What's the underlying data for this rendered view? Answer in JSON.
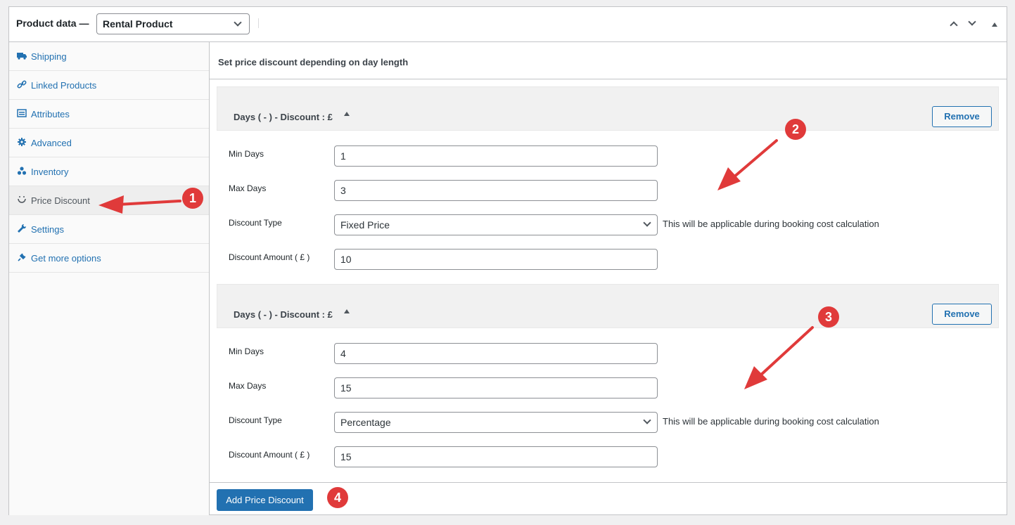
{
  "header": {
    "title": "Product data —",
    "product_type": "Rental Product"
  },
  "sidebar": {
    "items": [
      {
        "label": "Shipping",
        "icon": "truck-icon"
      },
      {
        "label": "Linked Products",
        "icon": "link-icon"
      },
      {
        "label": "Attributes",
        "icon": "list-icon"
      },
      {
        "label": "Advanced",
        "icon": "gear-icon"
      },
      {
        "label": "Inventory",
        "icon": "cubes-icon"
      },
      {
        "label": "Price Discount",
        "icon": "spinner-icon",
        "active": true
      },
      {
        "label": "Settings",
        "icon": "wrench-icon"
      },
      {
        "label": "Get more options",
        "icon": "plug-icon"
      }
    ]
  },
  "main": {
    "heading": "Set price discount depending on day length",
    "rules": [
      {
        "title": "Days ( - ) - Discount : £",
        "remove_label": "Remove",
        "min_days_label": "Min Days",
        "min_days": "1",
        "max_days_label": "Max Days",
        "max_days": "3",
        "discount_type_label": "Discount Type",
        "discount_type": "Fixed Price",
        "discount_type_hint": "This will be applicable during booking cost calculation",
        "discount_amount_label": "Discount Amount ( £ )",
        "discount_amount": "10"
      },
      {
        "title": "Days ( - ) - Discount : £",
        "remove_label": "Remove",
        "min_days_label": "Min Days",
        "min_days": "4",
        "max_days_label": "Max Days",
        "max_days": "15",
        "discount_type_label": "Discount Type",
        "discount_type": "Percentage",
        "discount_type_hint": "This will be applicable during booking cost calculation",
        "discount_amount_label": "Discount Amount ( £ )",
        "discount_amount": "15"
      }
    ],
    "add_label": "Add Price Discount"
  },
  "annotations": {
    "badges": [
      "1",
      "2",
      "3",
      "4"
    ],
    "color": "#e03a3a"
  },
  "colors": {
    "accent": "#2271b1",
    "annotation": "#e03a3a"
  }
}
